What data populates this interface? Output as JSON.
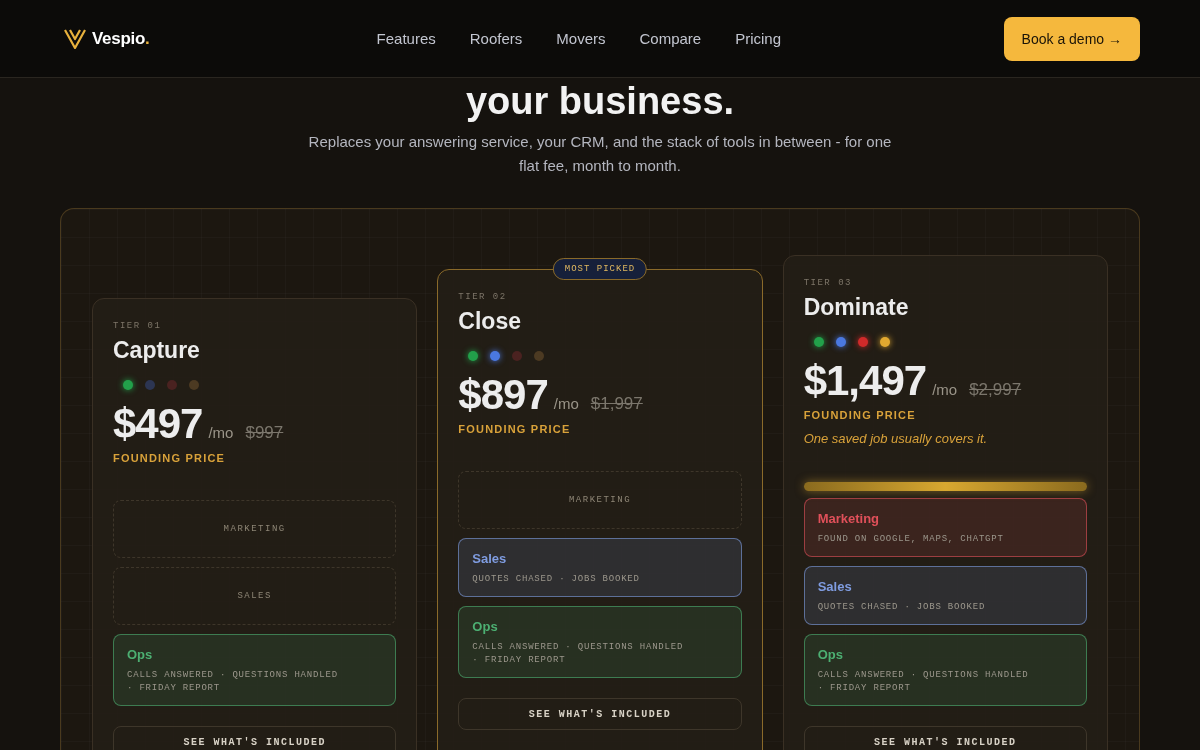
{
  "header": {
    "logo": {
      "name": "Vespio",
      "mark": "."
    },
    "nav": [
      "Features",
      "Roofers",
      "Movers",
      "Compare",
      "Pricing"
    ],
    "cta": "Book a demo →"
  },
  "hero": {
    "title": "your business.",
    "subtitle": "Replaces your answering service, your CRM, and the stack of tools in between - for one flat fee, month to month."
  },
  "tiers": [
    {
      "tier": "TIER 01",
      "name": "Capture",
      "featured": false,
      "boosted": false,
      "dots": [
        {
          "color": "#22a04a",
          "on": true
        },
        {
          "color": "#2c3552",
          "on": false
        },
        {
          "color": "#4a2220",
          "on": false
        },
        {
          "color": "#4c3a22",
          "on": false
        }
      ],
      "price": "$497",
      "per": "/mo",
      "old_price": "$997",
      "founding": "FOUNDING PRICE",
      "modules": [
        {
          "title": "MARKETING",
          "active": false
        },
        {
          "title": "SALES",
          "active": false
        },
        {
          "title": "Ops",
          "active": true,
          "color": "#4caf72",
          "detail": "CALLS ANSWERED · QUESTIONS HANDLED · FRIDAY REPORT"
        }
      ],
      "button": "SEE WHAT'S INCLUDED"
    },
    {
      "tier": "TIER 02",
      "name": "Close",
      "featured": true,
      "badge": "MOST PICKED",
      "boosted": false,
      "dots": [
        {
          "color": "#22a04a",
          "on": true
        },
        {
          "color": "#4a78e0",
          "on": true
        },
        {
          "color": "#4a2220",
          "on": false
        },
        {
          "color": "#4c3a22",
          "on": false
        }
      ],
      "price": "$897",
      "per": "/mo",
      "old_price": "$1,997",
      "founding": "FOUNDING PRICE",
      "modules": [
        {
          "title": "MARKETING",
          "active": false
        },
        {
          "title": "Sales",
          "active": true,
          "color": "#7f9ce0",
          "detail": "QUOTES CHASED · JOBS BOOKED"
        },
        {
          "title": "Ops",
          "active": true,
          "color": "#4caf72",
          "detail": "CALLS ANSWERED · QUESTIONS HANDLED · FRIDAY REPORT"
        }
      ],
      "button": "SEE WHAT'S INCLUDED"
    },
    {
      "tier": "TIER 03",
      "name": "Dominate",
      "featured": false,
      "boosted": true,
      "dots": [
        {
          "color": "#22a04a",
          "on": true
        },
        {
          "color": "#4a78e0",
          "on": true
        },
        {
          "color": "#d02a2a",
          "on": true
        },
        {
          "color": "#e0a830",
          "on": true
        }
      ],
      "price": "$1,497",
      "per": "/mo",
      "old_price": "$2,997",
      "founding": "FOUNDING PRICE",
      "note": "One saved job usually covers it.",
      "modules": [
        {
          "title": "Marketing",
          "active": true,
          "color": "#e0505a",
          "detail": "FOUND ON GOOGLE, MAPS, CHATGPT"
        },
        {
          "title": "Sales",
          "active": true,
          "color": "#7f9ce0",
          "detail": "QUOTES CHASED · JOBS BOOKED"
        },
        {
          "title": "Ops",
          "active": true,
          "color": "#4caf72",
          "detail": "CALLS ANSWERED · QUESTIONS HANDLED · FRIDAY REPORT"
        }
      ],
      "button": "SEE WHAT'S INCLUDED"
    }
  ]
}
